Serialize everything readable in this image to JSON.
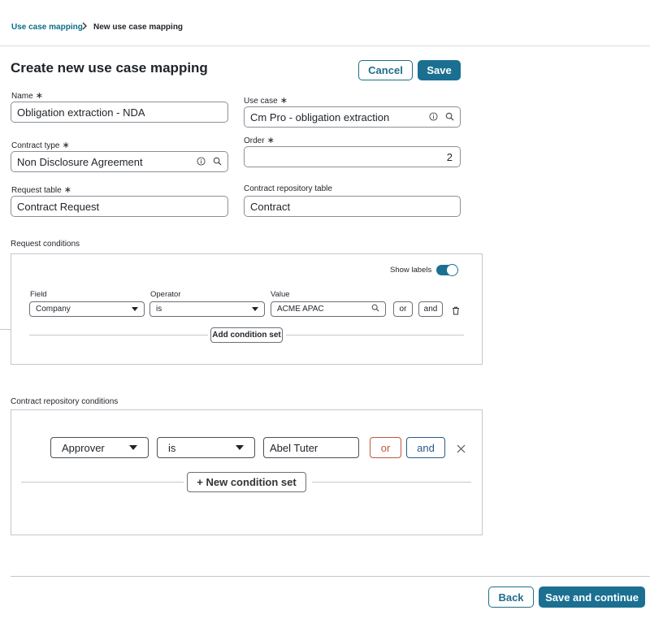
{
  "breadcrumb": {
    "parent": "Use case mapping",
    "current": "New use case mapping"
  },
  "page": {
    "title": "Create new use case mapping"
  },
  "header_actions": {
    "cancel": "Cancel",
    "save": "Save"
  },
  "form": {
    "name": {
      "label": "Name",
      "required_mark": "∗",
      "value": "Obligation extraction - NDA"
    },
    "use_case": {
      "label": "Use case",
      "required_mark": "∗",
      "value": "Cm Pro - obligation extraction"
    },
    "contract_type": {
      "label": "Contract type",
      "required_mark": "∗",
      "value": "Non Disclosure Agreement"
    },
    "order": {
      "label": "Order",
      "required_mark": "∗",
      "value": "2"
    },
    "request_table": {
      "label": "Request table",
      "required_mark": "∗",
      "value": "Contract Request"
    },
    "contract_repository_table": {
      "label": "Contract repository table",
      "value": "Contract"
    }
  },
  "request_conditions": {
    "label": "Request conditions",
    "show_labels": "Show labels",
    "show_labels_on": true,
    "field_label": "Field",
    "operator_label": "Operator",
    "value_label": "Value",
    "field_value": "Company",
    "operator_value": "is",
    "value_value": "ACME APAC",
    "or": "or",
    "and": "and",
    "add_set": "Add condition set"
  },
  "repo_conditions": {
    "label": "Contract repository conditions",
    "field_value": "Approver",
    "operator_value": "is",
    "value_value": "Abel Tuter",
    "or": "or",
    "and": "and",
    "new_set": "+ New condition set"
  },
  "footer": {
    "back": "Back",
    "save_continue": "Save and continue"
  },
  "colors": {
    "accent": "#1b7092",
    "or_border": "#c0573f",
    "and_border": "#2a5a8a"
  }
}
